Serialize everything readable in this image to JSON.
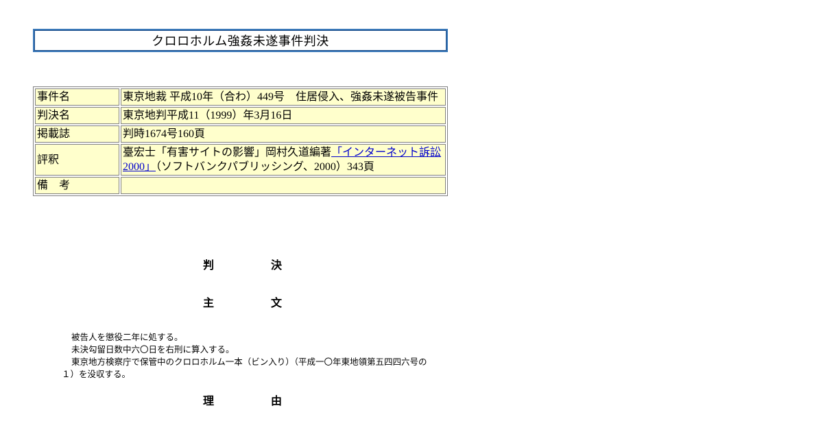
{
  "document": {
    "title": "クロロホルム強姦未遂事件判決"
  },
  "info_table": {
    "rows": [
      {
        "label": "事件名",
        "value": "東京地裁 平成10年（合わ）449号　住居侵入、強姦未遂被告事件"
      },
      {
        "label": "判決名",
        "value": "東京地判平成11（1999）年3月16日"
      },
      {
        "label": "掲載誌",
        "value": "判時1674号160頁"
      },
      {
        "label": "評釈",
        "value_before": "臺宏士「有害サイトの影響」岡村久道編著",
        "value_link": "「インターネット訴訟2000」",
        "value_after": "（ソフトバンクパブリッシング、2000）343頁"
      },
      {
        "label": "備　考",
        "value": ""
      }
    ]
  },
  "headings": {
    "judgment": [
      "判",
      "決"
    ],
    "main_text": [
      "主",
      "文"
    ],
    "reasons": [
      "理",
      "由"
    ]
  },
  "main_text_paragraphs": [
    "被告人を懲役二年に処する。",
    "未決勾留日数中六〇日を右刑に算入する。",
    "東京地方検察庁で保管中のクロロホルム一本（ビン入り）（平成一〇年東地領第五四四六号の１）を没収する。"
  ]
}
